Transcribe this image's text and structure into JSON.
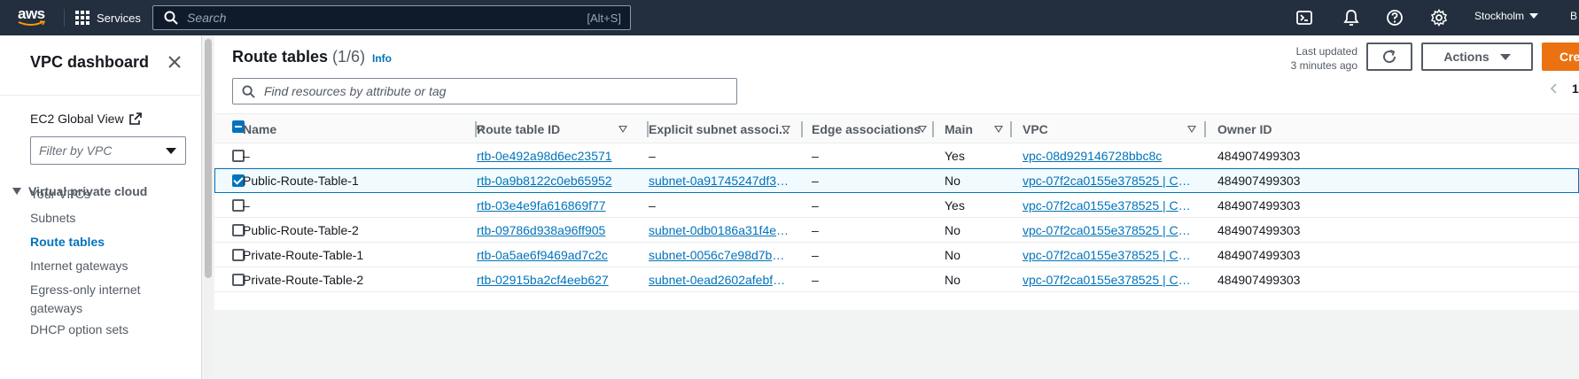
{
  "topnav": {
    "logo": "aws",
    "services_label": "Services",
    "search_placeholder": "Search",
    "search_shortcut": "[Alt+S]",
    "region": "Stockholm",
    "account_initial": "B"
  },
  "sidebar": {
    "title": "VPC dashboard",
    "ec2_global_view": "EC2 Global View",
    "filter_placeholder": "Filter by VPC",
    "section": "Virtual private cloud",
    "items": [
      {
        "label": "Your VPCs"
      },
      {
        "label": "Subnets"
      },
      {
        "label": "Route tables"
      },
      {
        "label": "Internet gateways"
      },
      {
        "label": "Egress-only internet gateways"
      },
      {
        "label": "DHCP option sets"
      }
    ]
  },
  "main": {
    "title": "Route tables",
    "count": "(1/6)",
    "info": "Info",
    "last_updated_line1": "Last updated",
    "last_updated_line2": "3 minutes ago",
    "actions_label": "Actions",
    "create_label": "Create route table",
    "filter_placeholder": "Find resources by attribute or tag",
    "page_number": "1"
  },
  "table": {
    "columns": [
      "Name",
      "Route table ID",
      "Explicit subnet associ...",
      "Edge associations",
      "Main",
      "VPC",
      "Owner ID"
    ],
    "rows": [
      {
        "selected": false,
        "name": "–",
        "id": "rtb-0e492a98d6ec23571",
        "subnet": "–",
        "edge": "–",
        "main": "Yes",
        "vpc": "vpc-08d929146728bbc8c",
        "owner": "484907499303"
      },
      {
        "selected": true,
        "name": "Public-Route-Table-1",
        "id": "rtb-0a9b8122c0eb65952",
        "subnet": "subnet-0a91745247df30...",
        "edge": "–",
        "main": "No",
        "vpc": "vpc-07f2ca0155e378525 | Caps...",
        "owner": "484907499303"
      },
      {
        "selected": false,
        "name": "–",
        "id": "rtb-03e4e9fa616869f77",
        "subnet": "–",
        "edge": "–",
        "main": "Yes",
        "vpc": "vpc-07f2ca0155e378525 | Caps...",
        "owner": "484907499303"
      },
      {
        "selected": false,
        "name": "Public-Route-Table-2",
        "id": "rtb-09786d938a96ff905",
        "subnet": "subnet-0db0186a31f4ec...",
        "edge": "–",
        "main": "No",
        "vpc": "vpc-07f2ca0155e378525 | Caps...",
        "owner": "484907499303"
      },
      {
        "selected": false,
        "name": "Private-Route-Table-1",
        "id": "rtb-0a5ae6f9469ad7c2c",
        "subnet": "subnet-0056c7e98d7b15...",
        "edge": "–",
        "main": "No",
        "vpc": "vpc-07f2ca0155e378525 | Caps...",
        "owner": "484907499303"
      },
      {
        "selected": false,
        "name": "Private-Route-Table-2",
        "id": "rtb-02915ba2cf4eeb627",
        "subnet": "subnet-0ead2602afebf6e...",
        "edge": "–",
        "main": "No",
        "vpc": "vpc-07f2ca0155e378525 | Caps...",
        "owner": "484907499303"
      }
    ]
  },
  "colors": {
    "nav_bg": "#232f3e",
    "link": "#0073bb",
    "primary_button": "#ec7211"
  }
}
